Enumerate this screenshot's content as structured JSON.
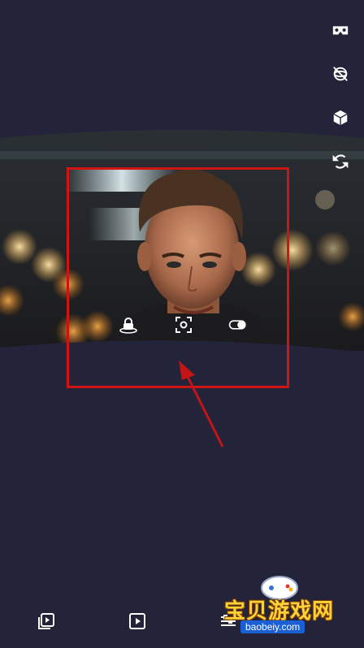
{
  "toolbar": {
    "icons": [
      "vr-headset-icon",
      "gyroscope-off-icon",
      "cube-icon",
      "rotate-icon"
    ]
  },
  "preview": {
    "controls": [
      "lock-icon",
      "face-focus-icon",
      "toggle-icon"
    ]
  },
  "bottom_bar": {
    "icons": [
      "video-gallery-icon",
      "play-icon",
      "adjust-icon"
    ]
  },
  "watermark": {
    "text": "宝贝游戏网",
    "url": "baobeiy.com"
  },
  "colors": {
    "background": "#23243a",
    "highlight": "#d01414",
    "watermark_yellow": "#ffd23a"
  }
}
